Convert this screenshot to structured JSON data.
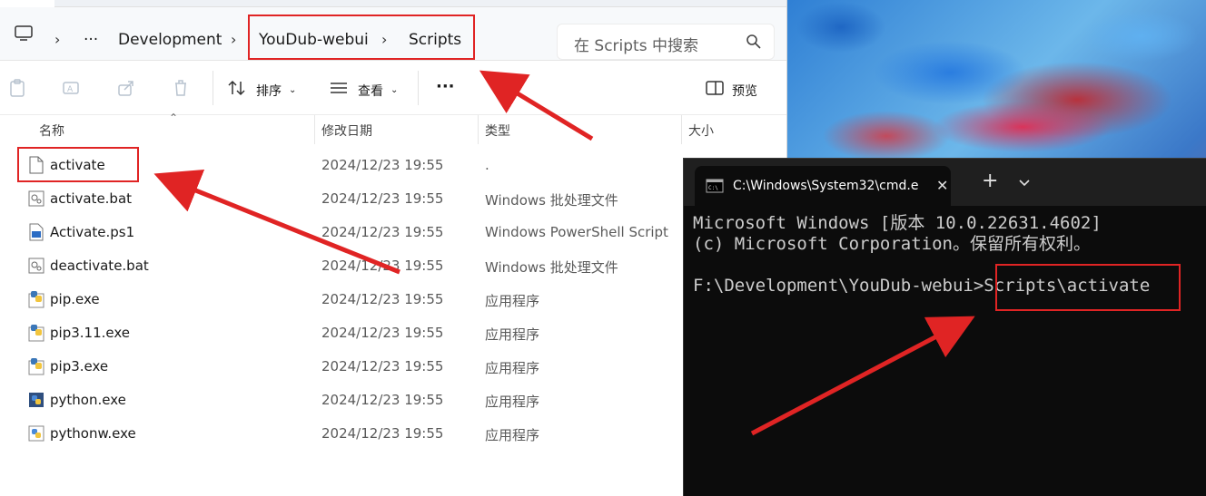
{
  "explorer": {
    "breadcrumb": [
      "Development",
      "YouDub-webui",
      "Scripts"
    ],
    "more_label": "···",
    "search_placeholder": "在 Scripts 中搜索",
    "toolbar": {
      "sort_label": "排序",
      "view_label": "查看",
      "more_label": "···",
      "preview_label": "预览"
    },
    "columns": {
      "name": "名称",
      "date": "修改日期",
      "type": "类型",
      "size": "大小"
    },
    "files": [
      {
        "name": "activate",
        "date": "2024/12/23 19:55",
        "type": ".",
        "icon": "blank-file-icon"
      },
      {
        "name": "activate.bat",
        "date": "2024/12/23 19:55",
        "type": "Windows 批处理文件",
        "icon": "batch-file-icon"
      },
      {
        "name": "Activate.ps1",
        "date": "2024/12/23 19:55",
        "type": "Windows PowerShell Script",
        "icon": "powershell-script-icon"
      },
      {
        "name": "deactivate.bat",
        "date": "2024/12/23 19:55",
        "type": "Windows 批处理文件",
        "icon": "batch-file-icon"
      },
      {
        "name": "pip.exe",
        "date": "2024/12/23 19:55",
        "type": "应用程序",
        "icon": "python-exe-icon"
      },
      {
        "name": "pip3.11.exe",
        "date": "2024/12/23 19:55",
        "type": "应用程序",
        "icon": "python-exe-icon"
      },
      {
        "name": "pip3.exe",
        "date": "2024/12/23 19:55",
        "type": "应用程序",
        "icon": "python-exe-icon"
      },
      {
        "name": "python.exe",
        "date": "2024/12/23 19:55",
        "type": "应用程序",
        "icon": "python-icon"
      },
      {
        "name": "pythonw.exe",
        "date": "2024/12/23 19:55",
        "type": "应用程序",
        "icon": "python-icon"
      }
    ]
  },
  "cmd": {
    "tab_title": "C:\\Windows\\System32\\cmd.e",
    "lines": [
      "Microsoft Windows [版本 10.0.22631.4602]",
      "(c) Microsoft Corporation。保留所有权利。",
      "",
      "F:\\Development\\YouDub-webui>Scripts\\activate"
    ]
  },
  "colors": {
    "annotation_red": "#e02424",
    "cmd_background": "#0c0c0c",
    "cmd_text": "#cccccc"
  }
}
